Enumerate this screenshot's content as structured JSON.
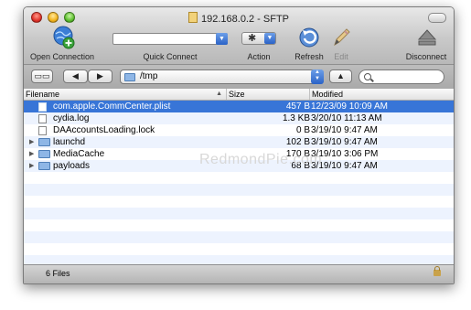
{
  "window": {
    "title": "192.168.0.2 - SFTP"
  },
  "toolbar": {
    "open_connection": "Open Connection",
    "quick_connect": "Quick Connect",
    "action": "Action",
    "refresh": "Refresh",
    "edit": "Edit",
    "disconnect": "Disconnect"
  },
  "pathbar": {
    "path": "/tmp"
  },
  "columns": {
    "filename": "Filename",
    "size": "Size",
    "modified": "Modified"
  },
  "files": [
    {
      "name": "com.apple.CommCenter.plist",
      "size": "457 B",
      "modified": "12/23/09 10:09 AM",
      "type": "file",
      "selected": true
    },
    {
      "name": "cydia.log",
      "size": "1.3 KB",
      "modified": "3/20/10 11:13 AM",
      "type": "file",
      "selected": false
    },
    {
      "name": "DAAccountsLoading.lock",
      "size": "0 B",
      "modified": "3/19/10 9:47 AM",
      "type": "file",
      "selected": false
    },
    {
      "name": "launchd",
      "size": "102 B",
      "modified": "3/19/10 9:47 AM",
      "type": "folder",
      "selected": false
    },
    {
      "name": "MediaCache",
      "size": "170 B",
      "modified": "3/19/10 3:06 PM",
      "type": "folder",
      "selected": false
    },
    {
      "name": "payloads",
      "size": "68 B",
      "modified": "3/19/10 9:47 AM",
      "type": "folder",
      "selected": false
    }
  ],
  "status": {
    "count": "6 Files"
  },
  "watermark": "RedmondPie.com",
  "colors": {
    "selection": "#3875d7",
    "stripe": "#edf3fe",
    "folder": "#8eb6e6"
  }
}
